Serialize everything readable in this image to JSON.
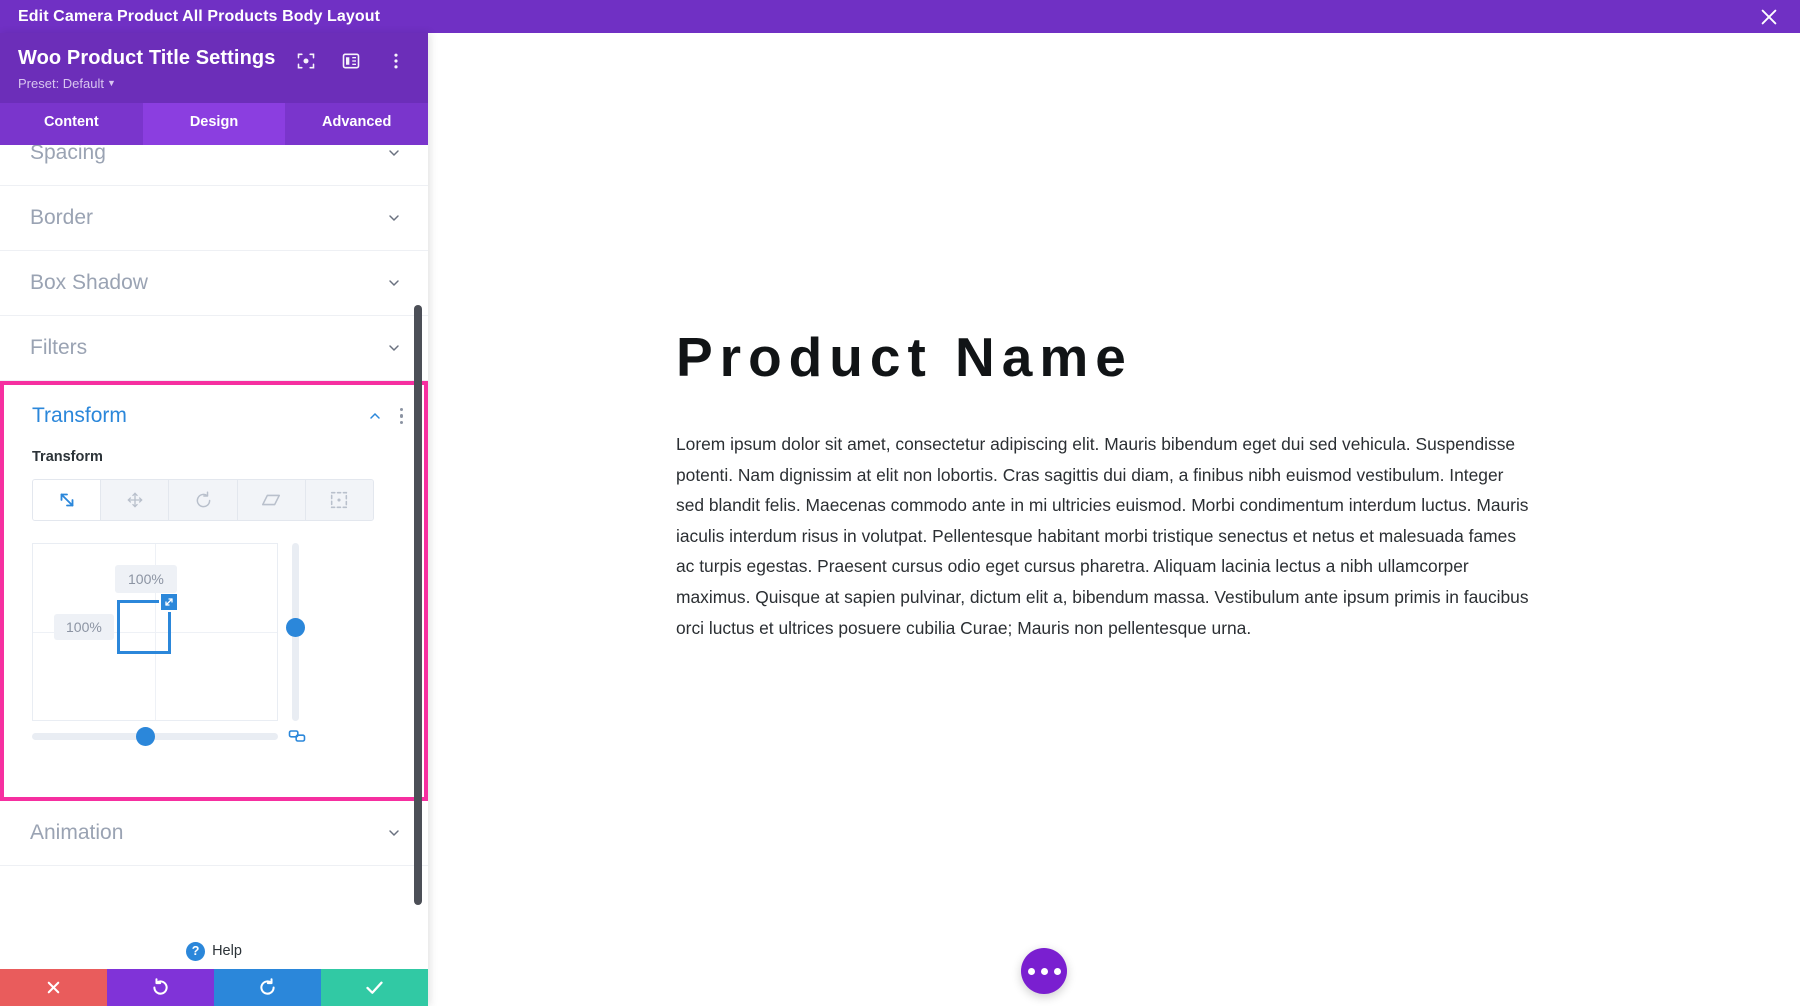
{
  "edit_bar": {
    "title": "Edit Camera Product All Products Body Layout",
    "close_icon": "close-icon"
  },
  "panel": {
    "title": "Woo Product Title Settings",
    "preset_label": "Preset: Default",
    "header_icons": [
      "focus-target-icon",
      "layout-columns-icon",
      "kebab-menu-icon"
    ],
    "tabs": [
      {
        "label": "Content",
        "active": false
      },
      {
        "label": "Design",
        "active": true
      },
      {
        "label": "Advanced",
        "active": false
      }
    ],
    "sections": [
      {
        "label": "Spacing",
        "expanded": false
      },
      {
        "label": "Border",
        "expanded": false
      },
      {
        "label": "Box Shadow",
        "expanded": false
      },
      {
        "label": "Filters",
        "expanded": false
      }
    ],
    "sections_after": [
      {
        "label": "Animation",
        "expanded": false
      }
    ],
    "transform": {
      "title": "Transform",
      "field_label": "Transform",
      "highlighted": true,
      "highlight_color": "#f62fa0",
      "accent_color": "#2b87da",
      "active_mode": "scale",
      "modes": [
        {
          "name": "scale-icon",
          "active": true
        },
        {
          "name": "translate-icon",
          "active": false
        },
        {
          "name": "rotate-icon",
          "active": false
        },
        {
          "name": "skew-icon",
          "active": false
        },
        {
          "name": "origin-icon",
          "active": false
        }
      ],
      "vertical_value": "100%",
      "horizontal_value": "100%",
      "link_icon": "link-axes-icon"
    },
    "help": {
      "label": "Help",
      "badge": "?"
    },
    "actions": [
      {
        "name": "cancel-button",
        "icon": "x-icon",
        "color": "#e95c5c"
      },
      {
        "name": "undo-button",
        "icon": "undo-icon",
        "color": "#8033d8"
      },
      {
        "name": "redo-button",
        "icon": "redo-icon",
        "color": "#2b87da"
      },
      {
        "name": "save-button",
        "icon": "check-icon",
        "color": "#31c9a4"
      }
    ]
  },
  "preview": {
    "product_title": "Product Name",
    "product_body": "Lorem ipsum dolor sit amet, consectetur adipiscing elit. Mauris bibendum eget dui sed vehicula. Suspendisse potenti. Nam dignissim at elit non lobortis. Cras sagittis dui diam, a finibus nibh euismod vestibulum. Integer sed blandit felis. Maecenas commodo ante in mi ultricies euismod. Morbi condimentum interdum luctus. Mauris iaculis interdum risus in volutpat. Pellentesque habitant morbi tristique senectus et netus et malesuada fames ac turpis egestas. Praesent cursus odio eget cursus pharetra. Aliquam lacinia lectus a nibh ullamcorper maximus. Quisque at sapien pulvinar, dictum elit a, bibendum massa. Vestibulum ante ipsum primis in faucibus orci luctus et ultrices posuere cubilia Curae; Mauris non pellentesque urna.",
    "fab": {
      "name": "more-options-fab",
      "icon": "ellipsis-icon"
    }
  }
}
